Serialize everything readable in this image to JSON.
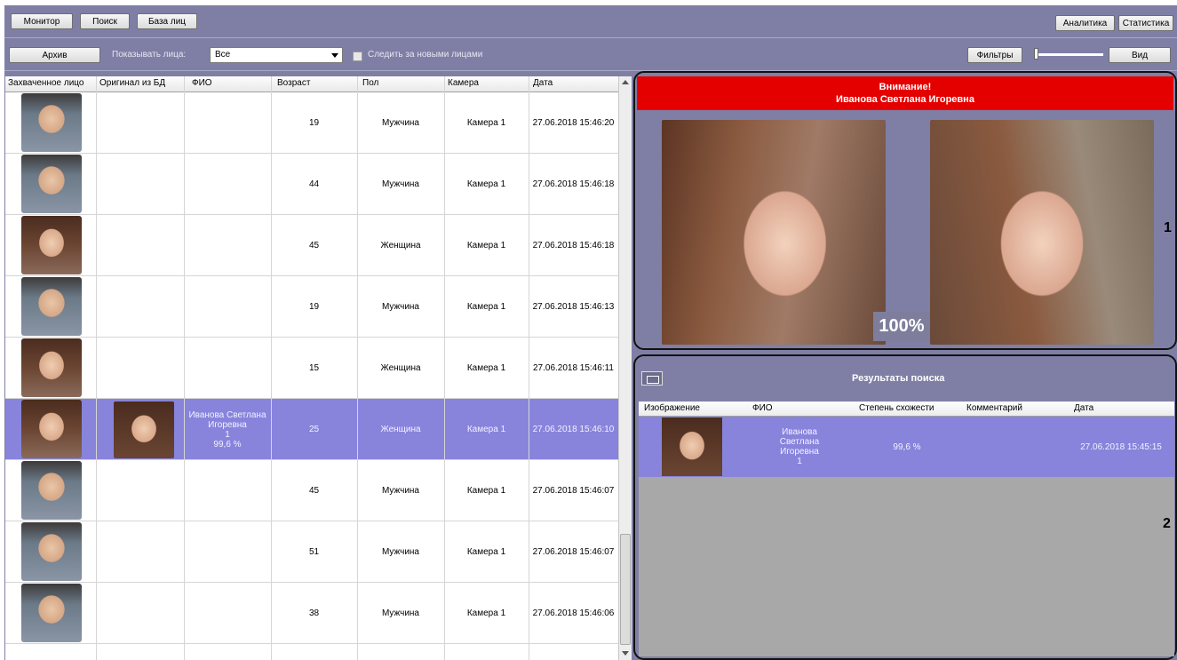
{
  "toolbar": {
    "monitor": "Монитор",
    "search": "Поиск",
    "face_db": "База лиц",
    "analytics": "Аналитика",
    "statistics": "Статистика"
  },
  "filterbar": {
    "archive": "Архив",
    "show_faces_label": "Показывать лица:",
    "show_faces_value": "Все",
    "follow_label": "Следить за новыми лицами",
    "filters": "Фильтры",
    "view": "Вид"
  },
  "grid": {
    "columns": [
      "Захваченное лицо",
      "Оригинал из БД",
      "ФИО",
      "Возраст",
      "Пол",
      "Камера",
      "Дата"
    ],
    "rows": [
      {
        "age": "19",
        "gender": "Мужчина",
        "camera": "Камера 1",
        "date": "27.06.2018 15:46:20",
        "face": "m"
      },
      {
        "age": "44",
        "gender": "Мужчина",
        "camera": "Камера 1",
        "date": "27.06.2018 15:46:18",
        "face": "m"
      },
      {
        "age": "45",
        "gender": "Женщина",
        "camera": "Камера 1",
        "date": "27.06.2018 15:46:18",
        "face": "w"
      },
      {
        "age": "19",
        "gender": "Мужчина",
        "camera": "Камера 1",
        "date": "27.06.2018 15:46:13",
        "face": "m"
      },
      {
        "age": "15",
        "gender": "Женщина",
        "camera": "Камера 1",
        "date": "27.06.2018 15:46:11",
        "face": "w"
      },
      {
        "age": "25",
        "gender": "Женщина",
        "camera": "Камера 1",
        "date": "27.06.2018 15:46:10",
        "face": "w",
        "selected": true,
        "fio_lines": [
          "Иванова Светлана",
          "Игоревна",
          "1",
          "99,6 %"
        ]
      },
      {
        "age": "45",
        "gender": "Мужчина",
        "camera": "Камера 1",
        "date": "27.06.2018 15:46:07",
        "face": "m"
      },
      {
        "age": "51",
        "gender": "Мужчина",
        "camera": "Камера 1",
        "date": "27.06.2018 15:46:07",
        "face": "m"
      },
      {
        "age": "38",
        "gender": "Мужчина",
        "camera": "Камера 1",
        "date": "27.06.2018 15:46:06",
        "face": "m"
      }
    ]
  },
  "alert": {
    "line1": "Внимание!",
    "line2": "Иванова Светлана Игоревна",
    "match_percent": "100%"
  },
  "markers": {
    "panel1": "1",
    "panel2": "2"
  },
  "results": {
    "title": "Результаты поиска",
    "columns": [
      "Изображение",
      "ФИО",
      "Степень схожести",
      "Комментарий",
      "Дата"
    ],
    "row": {
      "fio_lines": [
        "Иванова",
        "Светлана",
        "Игоревна",
        "1"
      ],
      "similarity": "99,6 %",
      "comment": "",
      "date": "27.06.2018 15:45:15"
    }
  },
  "colors": {
    "window_bg": "#7f7fa6",
    "selected_row": "#8884dc",
    "alert_red": "#e50000"
  }
}
